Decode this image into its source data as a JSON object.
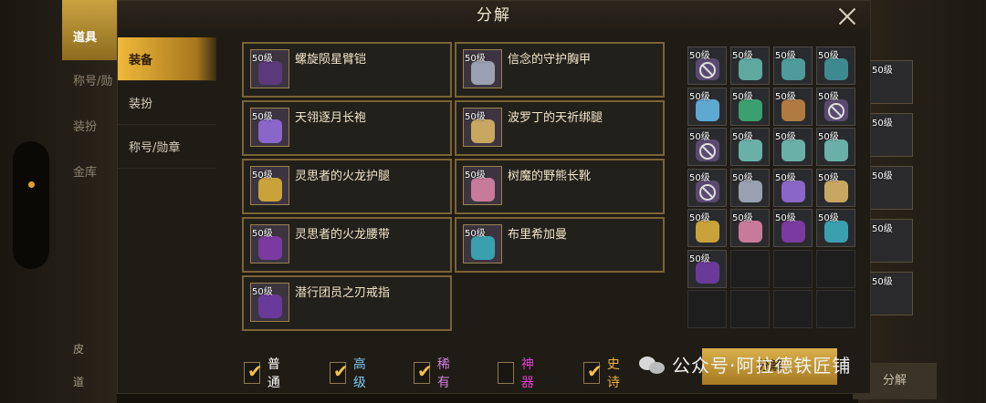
{
  "background": {
    "tabs": [
      "道具",
      "称号/勋",
      "装扮",
      "金库"
    ],
    "bottom_items": [
      "皮",
      "道"
    ],
    "right_slots": [
      "50级",
      "50级",
      "50级",
      "50级",
      "50级"
    ],
    "right_button": "分解"
  },
  "modal": {
    "title": "分解",
    "sidebar": [
      {
        "label": "装备",
        "active": true
      },
      {
        "label": "装扮",
        "active": false
      },
      {
        "label": "称号/勋章",
        "active": false
      }
    ],
    "items": [
      {
        "level": "50级",
        "name": "螺旋陨星臂铠",
        "color": "#5a3a7a"
      },
      {
        "level": "50级",
        "name": "信念的守护胸甲",
        "color": "#9aa0b0"
      },
      {
        "level": "50级",
        "name": "天翎逐月长袍",
        "color": "#8a66c8"
      },
      {
        "level": "50级",
        "name": "波罗丁的天祈绑腿",
        "color": "#c8a860"
      },
      {
        "level": "50级",
        "name": "灵思者的火龙护腿",
        "color": "#c9a23a"
      },
      {
        "level": "50级",
        "name": "树魔的野熊长靴",
        "color": "#c87a9a"
      },
      {
        "level": "50级",
        "name": "灵思者的火龙腰带",
        "color": "#7a3aa0"
      },
      {
        "level": "50级",
        "name": "布里希加曼",
        "color": "#3aa0b0"
      },
      {
        "level": "50级",
        "name": "潜行团员之刃戒指",
        "color": "#6a3a9a"
      }
    ],
    "slots": [
      {
        "level": "50级",
        "banned": true,
        "color": "#5a4a70"
      },
      {
        "level": "50级",
        "banned": false,
        "color": "#5fa8a0"
      },
      {
        "level": "50级",
        "banned": false,
        "color": "#4f9a9a"
      },
      {
        "level": "50级",
        "banned": false,
        "color": "#3f8a90"
      },
      {
        "level": "50级",
        "banned": false,
        "color": "#5fa8d0"
      },
      {
        "level": "50级",
        "banned": false,
        "color": "#3aa070"
      },
      {
        "level": "50级",
        "banned": false,
        "color": "#b07a40"
      },
      {
        "level": "50级",
        "banned": true,
        "color": "#5a4a70"
      },
      {
        "level": "50级",
        "banned": true,
        "color": "#5a4a70"
      },
      {
        "level": "50级",
        "banned": false,
        "color": "#6ab0a8"
      },
      {
        "level": "50级",
        "banned": false,
        "color": "#6ab0a8"
      },
      {
        "level": "50级",
        "banned": false,
        "color": "#6ab0a8"
      },
      {
        "level": "50级",
        "banned": true,
        "color": "#5a4a70"
      },
      {
        "level": "50级",
        "banned": false,
        "color": "#9aa0b0"
      },
      {
        "level": "50级",
        "banned": false,
        "color": "#8a66c8"
      },
      {
        "level": "50级",
        "banned": false,
        "color": "#c8a860"
      },
      {
        "level": "50级",
        "banned": false,
        "color": "#c9a23a"
      },
      {
        "level": "50级",
        "banned": false,
        "color": "#c87a9a"
      },
      {
        "level": "50级",
        "banned": false,
        "color": "#7a3aa0"
      },
      {
        "level": "50级",
        "banned": false,
        "color": "#3aa0b0"
      },
      {
        "level": "50级",
        "banned": false,
        "color": "#6a3a9a"
      }
    ],
    "filters": [
      {
        "label": "普通",
        "checked": true,
        "color": "#ffffff"
      },
      {
        "label": "高级",
        "checked": true,
        "color": "#7ec8f0"
      },
      {
        "label": "稀有",
        "checked": true,
        "color": "#d080e0"
      },
      {
        "label": "神器",
        "checked": false,
        "color": "#e040d0"
      },
      {
        "label": "史诗",
        "checked": true,
        "color": "#f0b040"
      }
    ],
    "decompose_label": "分解"
  },
  "watermark": {
    "text": "公众号·阿拉德铁匠铺"
  }
}
